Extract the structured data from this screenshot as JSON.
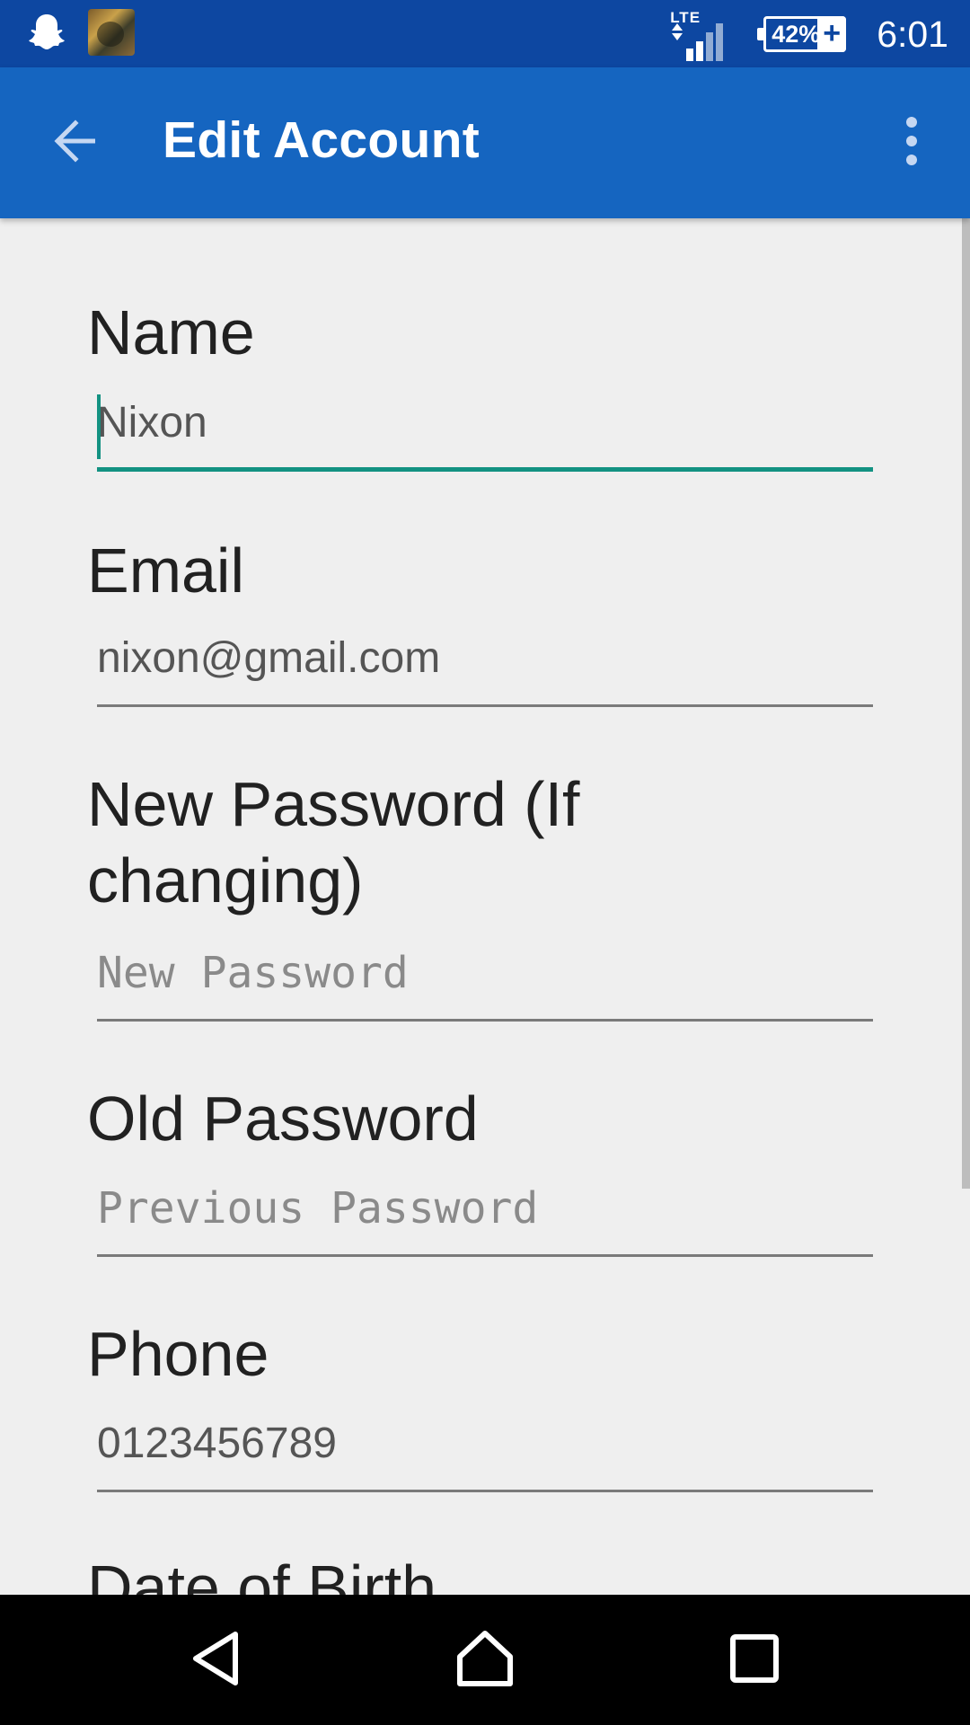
{
  "status_bar": {
    "network": "LTE",
    "battery": "42%",
    "battery_charging": "+",
    "time": "6:01",
    "icons": [
      "snapchat-icon",
      "game-app-icon",
      "lte-signal-icon",
      "battery-icon"
    ]
  },
  "app_bar": {
    "title": "Edit Account",
    "back_icon": "arrow-left-icon",
    "menu_icon": "more-vert-icon"
  },
  "form": {
    "name": {
      "label": "Name",
      "value": "Nixon"
    },
    "email": {
      "label": "Email",
      "value": "nixon@gmail.com"
    },
    "new_password": {
      "label": "New Password (If changing)",
      "placeholder": "New Password"
    },
    "old_password": {
      "label": "Old Password",
      "placeholder": "Previous Password"
    },
    "phone": {
      "label": "Phone",
      "value": "0123456789"
    },
    "dob": {
      "label": "Date of Birth"
    }
  },
  "colors": {
    "status_bar": "#0d47a1",
    "app_bar": "#1565c0",
    "accent": "#139282",
    "background": "#efefef"
  }
}
